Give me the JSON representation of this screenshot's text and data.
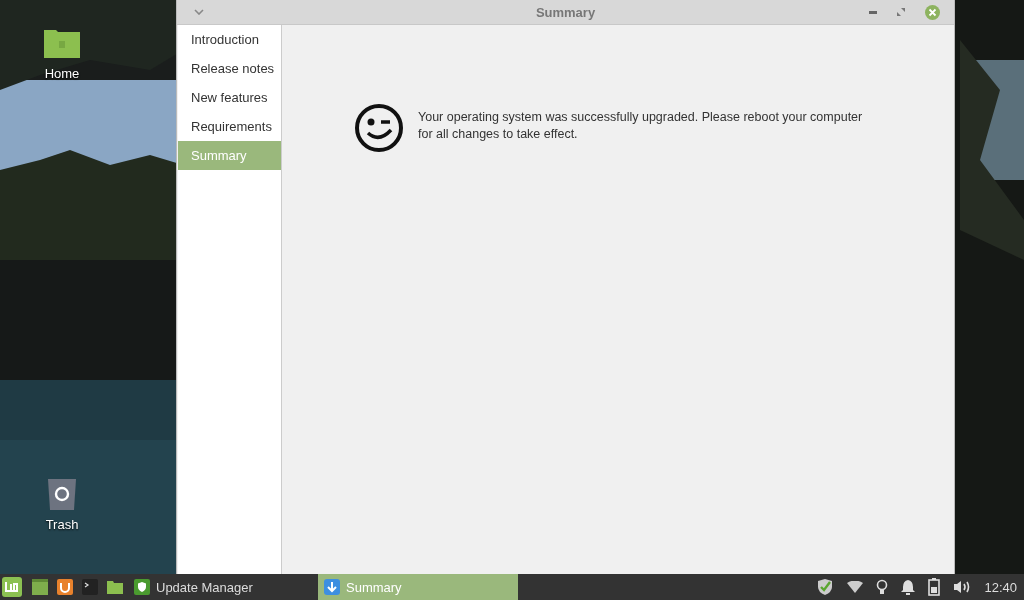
{
  "desktop": {
    "icons": [
      {
        "kind": "folder",
        "label": "Home"
      },
      {
        "kind": "trash",
        "label": "Trash"
      }
    ]
  },
  "window": {
    "title": "Summary",
    "sidebar": [
      {
        "label": "Introduction",
        "selected": false
      },
      {
        "label": "Release notes",
        "selected": false
      },
      {
        "label": "New features",
        "selected": false
      },
      {
        "label": "Requirements",
        "selected": false
      },
      {
        "label": "Summary",
        "selected": true
      }
    ],
    "message": "Your operating system was successfully upgraded. Please reboot your computer for all changes to take effect."
  },
  "taskbar": {
    "launchers": [
      {
        "kind": "menu"
      },
      {
        "kind": "desktop"
      },
      {
        "kind": "software"
      },
      {
        "kind": "terminal"
      },
      {
        "kind": "files"
      }
    ],
    "tasks": [
      {
        "kind": "shield",
        "label": "Update Manager",
        "selected": false
      },
      {
        "kind": "download",
        "label": "Summary",
        "selected": true
      }
    ],
    "tray": [
      {
        "kind": "shield"
      },
      {
        "kind": "wifi"
      },
      {
        "kind": "bulb"
      },
      {
        "kind": "bell"
      },
      {
        "kind": "battery"
      },
      {
        "kind": "volume"
      }
    ],
    "clock": "12:40"
  }
}
